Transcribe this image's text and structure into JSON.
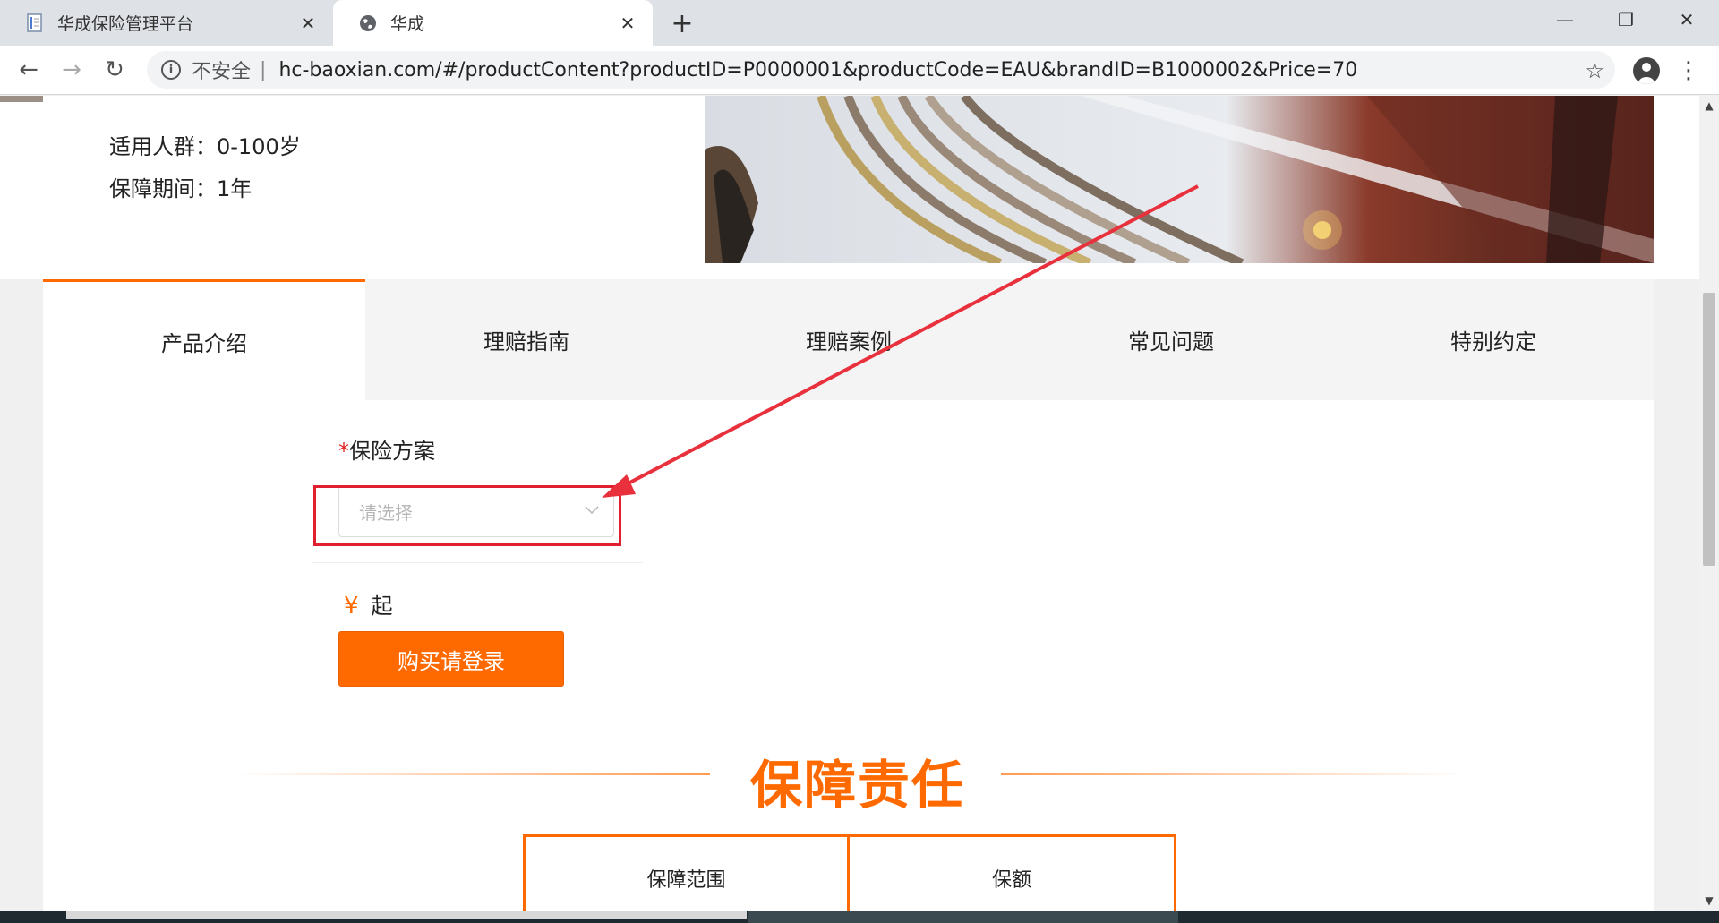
{
  "browser": {
    "tabs": [
      {
        "title": "华成保险管理平台",
        "icon": "page-icon",
        "active": false
      },
      {
        "title": "华成",
        "icon": "globe-icon",
        "active": true
      }
    ],
    "new_tab": "+",
    "omnibox": {
      "security_label": "不安全",
      "separator": "|",
      "url": "hc-baoxian.com/#/productContent?productID=P0000001&productCode=EAU&brandID=B1000002&Price=70"
    },
    "window_controls": {
      "minimize": "—",
      "restore": "❐",
      "close": "✕"
    },
    "nav": {
      "back": "←",
      "forward": "→",
      "reload": "↻"
    },
    "star": "☆",
    "menu": "⋮"
  },
  "product": {
    "audience": "适用人群：0-100岁",
    "period": "保障期间：1年"
  },
  "product_tabs": [
    "产品介绍",
    "理赔指南",
    "理赔案例",
    "常见问题",
    "特别约定"
  ],
  "active_tab_index": 0,
  "plan": {
    "required_mark": "*",
    "label": "保险方案",
    "select_placeholder": "请选择"
  },
  "price": {
    "currency": "¥",
    "suffix": "起"
  },
  "buy_button": "购买请登录",
  "coverage": {
    "title": "保障责任",
    "columns": [
      "保障范围",
      "保额"
    ]
  },
  "colors": {
    "accent": "#ff6a00",
    "highlight": "#e0202e"
  }
}
